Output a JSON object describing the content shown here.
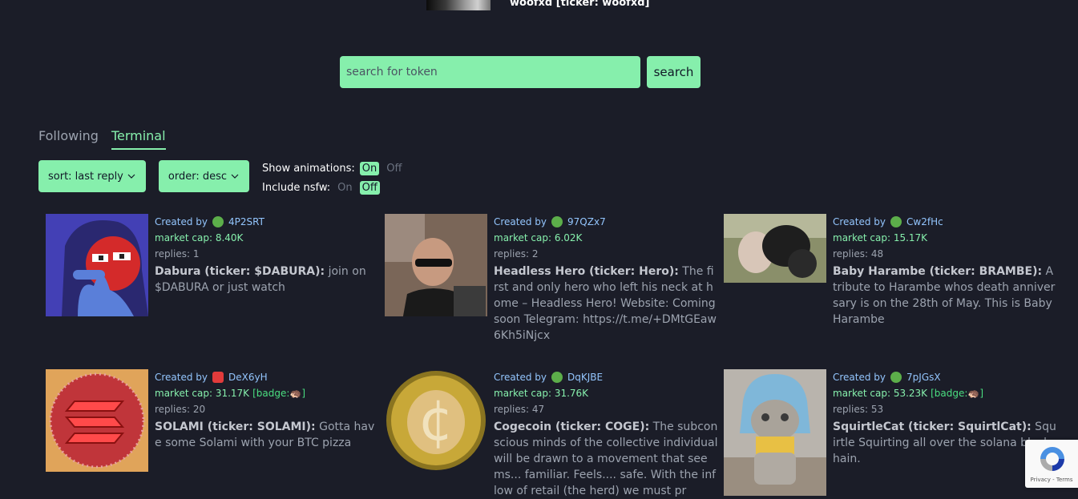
{
  "header": {
    "token_title": "woofxd [ticker: woofxd]"
  },
  "search": {
    "placeholder": "search for token",
    "button_label": "search"
  },
  "tabs": [
    {
      "label": "Following",
      "active": false
    },
    {
      "label": "Terminal",
      "active": true
    }
  ],
  "controls": {
    "sort_label": "sort: last reply",
    "order_label": "order: desc",
    "show_animations": {
      "label": "Show animations:",
      "on": "On",
      "off": "Off",
      "selected": "On"
    },
    "include_nsfw": {
      "label": "Include nsfw:",
      "on": "On",
      "off": "Off",
      "selected": "Off"
    }
  },
  "colors": {
    "accent": "#86efac",
    "background": "#1b1d28",
    "creator_link": "#93c5fd"
  },
  "tokens": [
    {
      "created_by_label": "Created by",
      "creator": "4P2SRT",
      "market_cap": "market cap: 8.40K",
      "badge": "",
      "replies": "replies: 1",
      "name": "Dabura (ticker: $DABURA):",
      "description": " join on $DABURA or just watch"
    },
    {
      "created_by_label": "Created by",
      "creator": "97QZx7",
      "market_cap": "market cap: 6.02K",
      "badge": "",
      "replies": "replies: 2",
      "name": "Headless Hero (ticker: Hero):",
      "description": " The first and only hero who left his neck at home – Headless Hero! Website: Coming soon Telegram: https://t.me/+DMtGEaw6Kh5iNjcx"
    },
    {
      "created_by_label": "Created by",
      "creator": "Cw2fHc",
      "market_cap": "market cap: 15.17K",
      "badge": "",
      "replies": "replies: 48",
      "name": "Baby Harambe (ticker: BRAMBE):",
      "description": " A tribute to Harambe whos death anniversary is on the 28th of May. This is Baby Harambe"
    },
    {
      "created_by_label": "Created by",
      "creator": "DeX6yH",
      "market_cap": "market cap: 31.17K",
      "badge": "[badge:🦔]",
      "replies": "replies: 20",
      "name": "SOLAMI (ticker: SOLAMI):",
      "description": " Gotta have some Solami with your BTC pizza"
    },
    {
      "created_by_label": "Created by",
      "creator": "DqKJBE",
      "market_cap": "market cap: 31.76K",
      "badge": "",
      "replies": "replies: 47",
      "name": "Cogecoin (ticker: COGE):",
      "description": " The subconscious minds of the collective individual will be drawn to a movement that seems... familiar. Feels.... safe. With the inflow of retail (the herd) we must pr"
    },
    {
      "created_by_label": "Created by",
      "creator": "7pJGsX",
      "market_cap": "market cap: 53.23K",
      "badge": "[badge:🦔]",
      "replies": "replies: 53",
      "name": "SquirtleCat (ticker: SquirtlCat):",
      "description": " Squirtle Squirting all over the solana blockchain."
    }
  ],
  "recaptcha": {
    "text": "Privacy - Terms"
  }
}
